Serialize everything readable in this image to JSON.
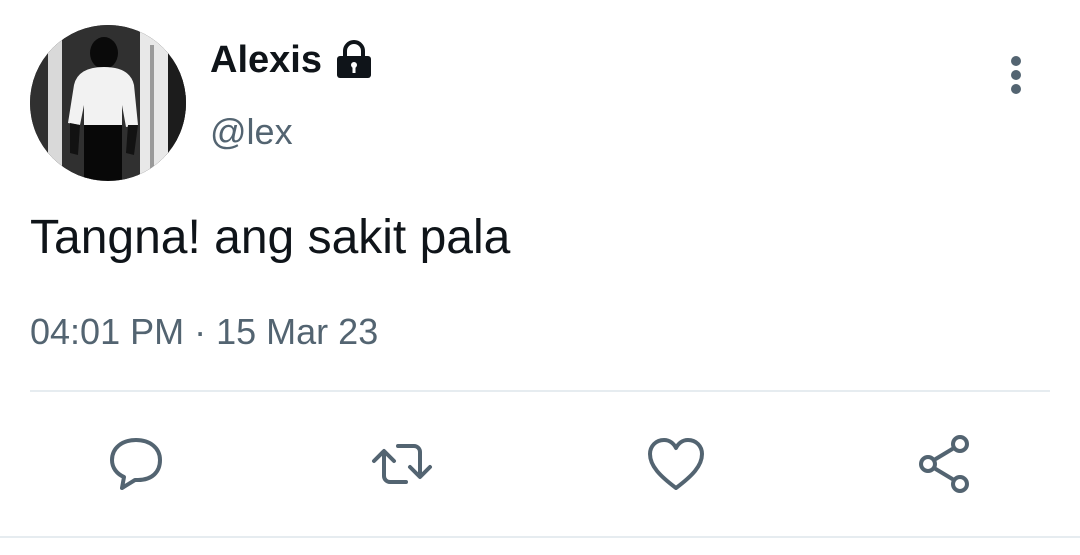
{
  "tweet": {
    "display_name": "Alexis",
    "handle": "@lex",
    "text": "Tangna! ang sakit pala",
    "time": "04:01 PM",
    "separator": "·",
    "date": "15 Mar 23"
  },
  "icons": {
    "lock": "lock-icon",
    "more": "vertical-dots-icon",
    "reply": "speech-bubble-icon",
    "retweet": "retweet-arrows-icon",
    "like": "heart-icon",
    "share": "share-nodes-icon"
  },
  "colors": {
    "text_primary": "#0f1419",
    "text_secondary": "#536471",
    "icon": "#536471",
    "divider": "#e6ecf0"
  }
}
